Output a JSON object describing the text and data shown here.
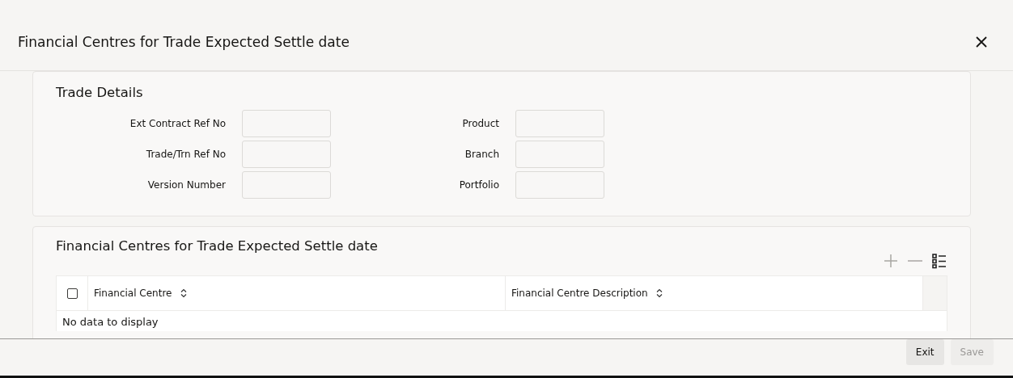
{
  "window": {
    "title": "Financial Centres for Trade Expected Settle date"
  },
  "trade_details": {
    "heading": "Trade Details",
    "fields": [
      {
        "label": "Ext Contract Ref No"
      },
      {
        "label": "Product"
      },
      {
        "label": "Trade/Trn Ref No"
      },
      {
        "label": "Branch"
      },
      {
        "label": "Version Number"
      },
      {
        "label": "Portfolio"
      }
    ]
  },
  "centres": {
    "heading": "Financial Centres for Trade Expected Settle date",
    "toolbar": [
      {
        "kind": "add",
        "disabled": true
      },
      {
        "kind": "remove",
        "disabled": true
      },
      {
        "kind": "list",
        "disabled": false
      }
    ],
    "table": {
      "select_all_checked": false,
      "columns": [
        "Financial Centre",
        "Financial Centre Description"
      ],
      "empty_text": "No data to display"
    }
  },
  "footer": {
    "buttons": [
      {
        "label": "Exit",
        "disabled": false
      },
      {
        "label": "Save",
        "disabled": true
      }
    ]
  }
}
